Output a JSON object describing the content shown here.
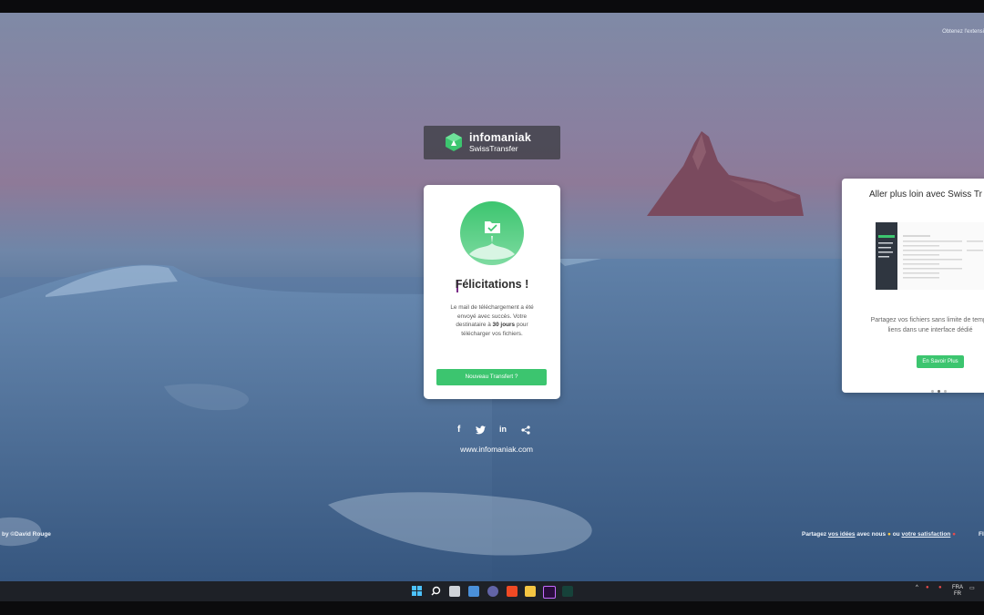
{
  "top_right_link": "Obtenez l'extensi",
  "photo_credit": "by ©David Rouge",
  "logo": {
    "brand": "infomaniak",
    "product": "SwissTransfer"
  },
  "success_card": {
    "title": "Félicitations !",
    "text_line1": "Le mail de téléchargement a été envoyé avec succès. Votre destinataire à ",
    "text_bold": "30 jours",
    "text_line2": " pour télécharger vos fichiers.",
    "button": "Nouveau Transfert ?"
  },
  "socials": [
    "f",
    "twitter-icon",
    "in",
    "share-icon"
  ],
  "site_link": "www.infomaniak.com",
  "promo_card": {
    "title": "Aller plus loin avec Swiss Tr",
    "text1": "Partagez vos fichiers sans limite de temps",
    "text2": "liens dans une interface dédié",
    "button": "En Savoir Plus"
  },
  "footer": {
    "prefix": "Partagez ",
    "ideas": "vos idées",
    "middle": " avec nous ",
    "or": " ou ",
    "satisfaction": "votre satisfaction",
    "lang": "FI"
  },
  "tray": {
    "lang_top": "FRA",
    "lang_bottom": "FR"
  },
  "colors": {
    "accent_green": "#3cc56f",
    "logo_bg": "#3c3c42"
  }
}
